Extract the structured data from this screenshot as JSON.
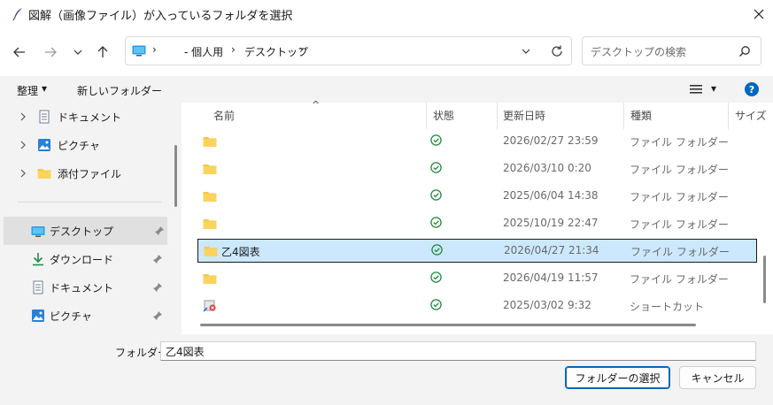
{
  "window": {
    "title": "図解（画像ファイル）が入っているフォルダを選択",
    "title_icon": "quill-pen-icon",
    "close_icon": "close-icon"
  },
  "nav": {
    "back_icon": "arrow-left-icon",
    "forward_icon": "arrow-right-icon",
    "recent_icon": "chevron-down-icon",
    "up_icon": "arrow-up-icon",
    "address": {
      "pc_icon": "desktop-pc-icon",
      "chevron": "›",
      "segments": [
        "- 個人用",
        "デスクトップ"
      ]
    },
    "search": {
      "placeholder": "デスクトップの検索"
    }
  },
  "toolbar": {
    "organize_label": "整理",
    "caret": "▾",
    "new_folder_label": "新しいフォルダー",
    "help": "?"
  },
  "sidebar": {
    "tree": [
      {
        "label": "ドキュメント",
        "icon": "document-icon"
      },
      {
        "label": "ピクチャ",
        "icon": "picture-icon"
      },
      {
        "label": "添付ファイル",
        "icon": "folder-icon"
      }
    ],
    "quick_access": [
      {
        "label": "デスクトップ",
        "icon": "desktop-icon",
        "selected": true
      },
      {
        "label": "ダウンロード",
        "icon": "download-icon"
      },
      {
        "label": "ドキュメント",
        "icon": "document-icon"
      },
      {
        "label": "ピクチャ",
        "icon": "picture-icon"
      }
    ]
  },
  "files": {
    "columns": [
      "名前",
      "状態",
      "更新日時",
      "種類",
      "サイズ"
    ],
    "sort_indicator": "^",
    "rows": [
      {
        "name": "",
        "date": "2026/02/27 23:59",
        "type": "ファイル フォルダー",
        "icon": "folder-icon"
      },
      {
        "name": "",
        "date": "2026/03/10 0:20",
        "type": "ファイル フォルダー",
        "icon": "folder-icon"
      },
      {
        "name": "",
        "date": "2025/06/04 14:38",
        "type": "ファイル フォルダー",
        "icon": "folder-icon"
      },
      {
        "name": "",
        "date": "2025/10/19 22:47",
        "type": "ファイル フォルダー",
        "icon": "folder-icon"
      },
      {
        "name": "乙4図表",
        "date": "2026/04/27 21:34",
        "type": "ファイル フォルダー",
        "icon": "folder-icon",
        "selected": true
      },
      {
        "name": "",
        "date": "2026/04/19 11:57",
        "type": "ファイル フォルダー",
        "icon": "folder-icon"
      },
      {
        "name": "",
        "date": "2025/03/02 9:32",
        "type": "ショートカット",
        "icon": "shortcut-icon"
      }
    ],
    "status_icon": "sync-check-icon"
  },
  "footer": {
    "folder_label": "フォルダー:",
    "folder_value": "乙4図表",
    "select_button": "フォルダーの選択",
    "cancel_button": "キャンセル"
  },
  "colors": {
    "accent": "#0067c0",
    "selection": "#cce8ff",
    "folder": "#f8c845",
    "status_green": "#1f8a3b"
  }
}
